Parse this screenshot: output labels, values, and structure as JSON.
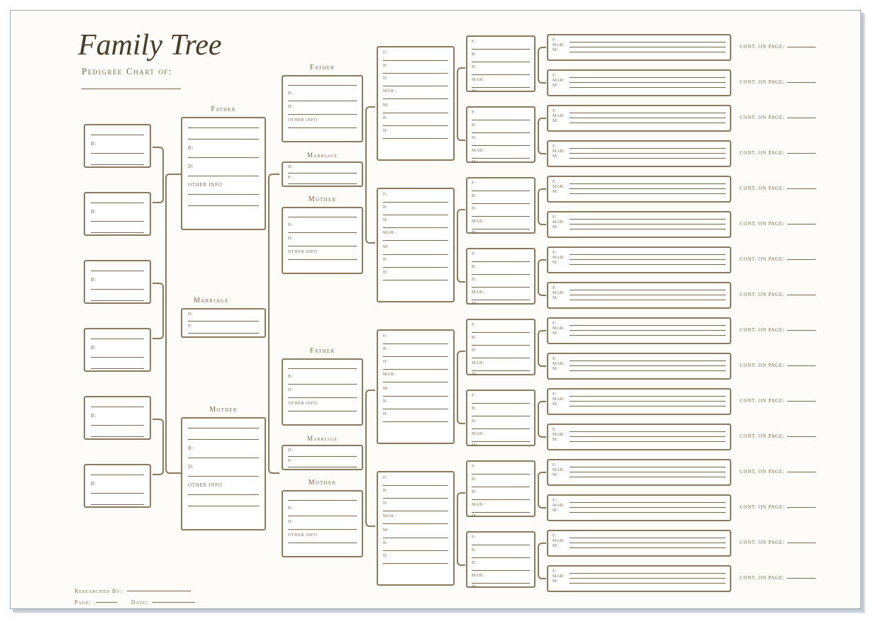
{
  "title": "Family Tree",
  "subtitle": "Pedigree Chart of:",
  "labels": {
    "father": "Father",
    "mother": "Mother",
    "marriage": "Marriage",
    "b": "B:",
    "d": "D:",
    "p": "P:",
    "f": "F:",
    "m": "M:",
    "mar": "MAR:",
    "other": "Other Info",
    "cont": "Cont. on Page:",
    "researched": "Researched By:",
    "page": "Page:",
    "date": "Date:"
  }
}
